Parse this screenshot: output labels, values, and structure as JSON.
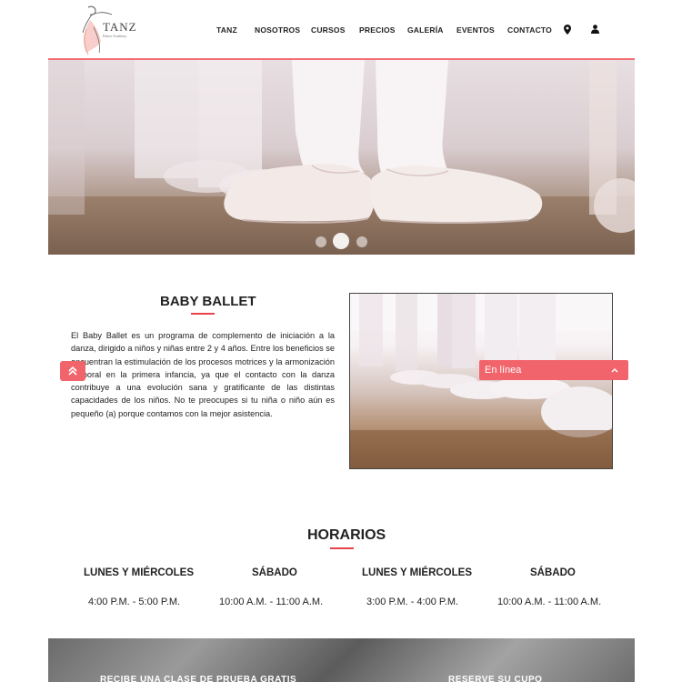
{
  "header": {
    "logo_text": "TANZ",
    "logo_subtitle": "Dance Academy",
    "nav": [
      {
        "label": "TANZ"
      },
      {
        "label": "NOSOTROS"
      },
      {
        "label": "CURSOS"
      },
      {
        "label": "PRECIOS"
      },
      {
        "label": "GALERÍA"
      },
      {
        "label": "EVENTOS"
      },
      {
        "label": "CONTACTO"
      }
    ],
    "icons": [
      "map-pin-icon",
      "user-icon"
    ],
    "accent_color": "#f26c72"
  },
  "hero": {
    "slides_count": 3,
    "active_slide": 2
  },
  "baby_ballet": {
    "title": "BABY BALLET",
    "body": "El Baby Ballet es un programa de complemento de iniciación a la danza, dirigido a niños y niñas entre 2 y 4 años. Entre los beneficios se encuentran la estimulación de los procesos motrices y la armonización corporal en la primera infancia, ya que el contacto con la danza contribuye a una evolución sana y gratificante de las distintas capacidades de los niños. No te preocupes si tu niña o niño aún es pequeño (a) porque contamos con la mejor asistencia."
  },
  "chat": {
    "label": "En línea",
    "color": "#f2646b"
  },
  "horarios": {
    "title": "HORARIOS",
    "columns": [
      {
        "day": "LUNES Y MIÉRCOLES",
        "time": "4:00 P.M. - 5:00 P.M."
      },
      {
        "day": "SÁBADO",
        "time": "10:00 A.M. - 11:00 A.M."
      },
      {
        "day": "LUNES Y MIÉRCOLES",
        "time": "3:00 P.M. - 4:00 P.M."
      },
      {
        "day": "SÁBADO",
        "time": "10:00 A.M. - 11:00 A.M."
      }
    ]
  },
  "banner": {
    "left_text": "RECIBE UNA CLASE DE PRUEBA GRATIS",
    "right_text": "RESERVE SU CUPO"
  }
}
